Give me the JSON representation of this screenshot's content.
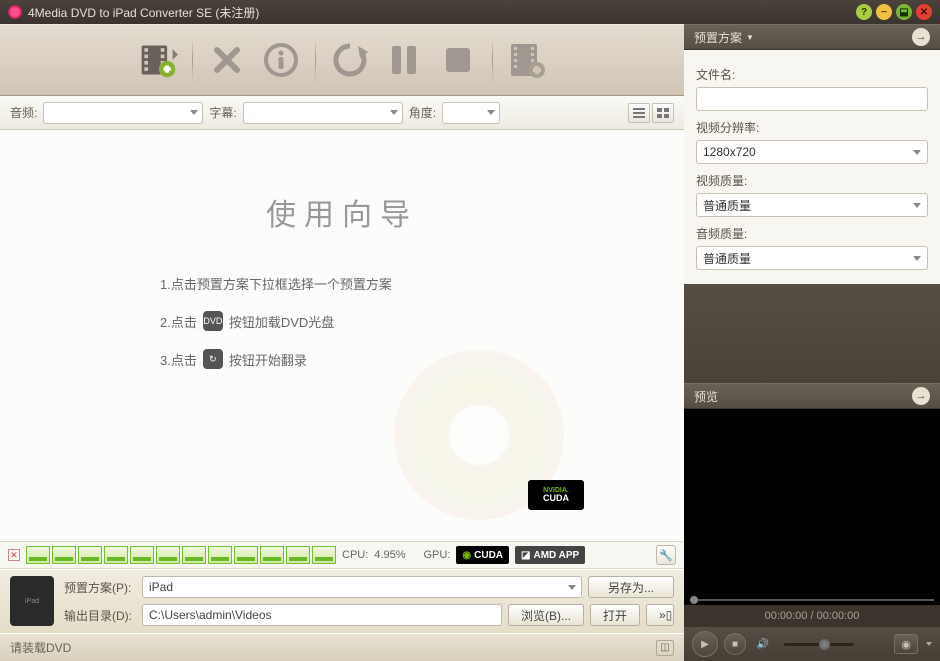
{
  "window": {
    "title": "4Media DVD to iPad Converter SE (未注册)"
  },
  "toolbar": {
    "add_file": "add-file",
    "delete": "delete",
    "info": "info",
    "convert": "convert",
    "pause": "pause",
    "stop": "stop",
    "add_clip": "add-clip"
  },
  "filters": {
    "audio_label": "音频:",
    "subtitle_label": "字幕:",
    "angle_label": "角度:",
    "audio_value": "",
    "subtitle_value": "",
    "angle_value": ""
  },
  "wizard": {
    "title": "使用向导",
    "step1": "1.点击预置方案下拉框选择一个预置方案",
    "step2a": "2.点击",
    "step2b": "按钮加载DVD光盘",
    "step3a": "3.点击",
    "step3b": "按钮开始翻录",
    "dvd_icon_label": "DVD"
  },
  "cuda": {
    "nv": "NVIDIA.",
    "cuda": "CUDA"
  },
  "cpu": {
    "label": "CPU:",
    "value": "4.95%",
    "gpu_label": "GPU:",
    "cuda_badge": "CUDA",
    "amd_badge": "AMD APP",
    "cores": 12
  },
  "output": {
    "profile_label": "预置方案(P):",
    "profile_value": "iPad",
    "save_as": "另存为...",
    "dest_label": "输出目录(D):",
    "dest_value": "C:\\Users\\admin\\Videos",
    "browse": "浏览(B)...",
    "open": "打开"
  },
  "status": {
    "text": "请装载DVD"
  },
  "profile_panel": {
    "header": "预置方案",
    "filename_label": "文件名:",
    "filename_value": "",
    "res_label": "视频分辨率:",
    "res_value": "1280x720",
    "vq_label": "视频质量:",
    "vq_value": "普通质量",
    "aq_label": "音频质量:",
    "aq_value": "普通质量"
  },
  "preview": {
    "header": "预览",
    "time": "00:00:00 / 00:00:00"
  }
}
